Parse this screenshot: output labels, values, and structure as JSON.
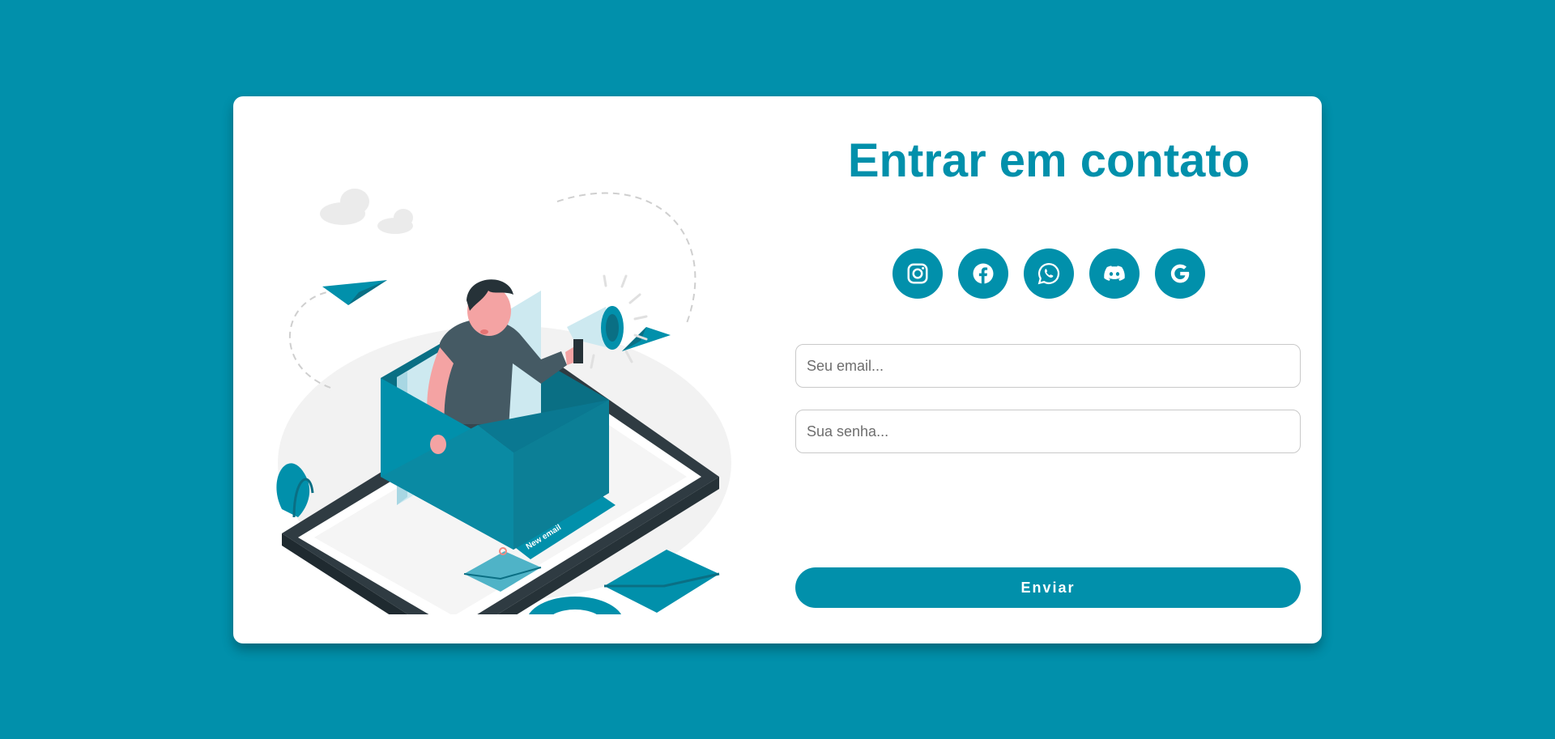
{
  "contact": {
    "title": "Entrar em contato",
    "email_placeholder": "Seu email...",
    "password_placeholder": "Sua senha...",
    "submit_label": "Enviar"
  },
  "socials": [
    {
      "icon": "instagram-icon"
    },
    {
      "icon": "facebook-icon"
    },
    {
      "icon": "whatsapp-icon"
    },
    {
      "icon": "discord-icon"
    },
    {
      "icon": "google-icon"
    }
  ],
  "illustration": {
    "badge_text": "New email"
  },
  "colors": {
    "background": "#0190ab",
    "accent": "#0190ab",
    "card": "#ffffff"
  }
}
